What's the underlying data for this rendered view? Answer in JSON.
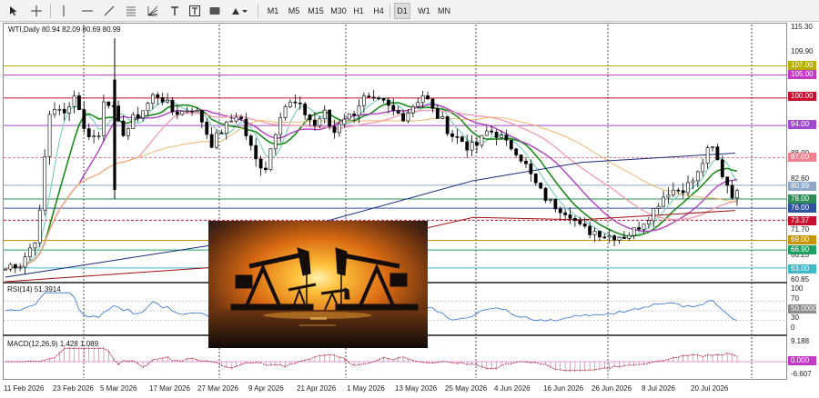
{
  "toolbar": {
    "tools": [
      "cursor-icon",
      "crosshair-icon",
      "vertical-line-icon",
      "horizontal-line-icon",
      "trendline-icon",
      "fibonacci-icon",
      "fibonacci-fan-icon",
      "text-icon",
      "rectangle-icon",
      "shapes-icon"
    ],
    "timeframes": [
      "M1",
      "M5",
      "M15",
      "M30",
      "H1",
      "H4",
      "D1",
      "W1",
      "MN"
    ],
    "active_timeframe": "D1"
  },
  "symbol_info": "WTI,Daily  80.94 82.09 80.69 80.99",
  "rsi": {
    "label": "RSI(14) 51.3914",
    "levels": [
      "100",
      "70",
      "50.0000",
      "30",
      "0"
    ]
  },
  "macd": {
    "label": "MACD(12,26,9) 1.428 1.089",
    "levels": [
      "9.188",
      "0.000",
      "-6.607"
    ]
  },
  "price_axis": [
    "115.30",
    "109.90",
    "88.00",
    "82.60",
    "71.70",
    "66.25",
    "60.85"
  ],
  "price_tags": [
    {
      "value": "107.00",
      "color": "#b5b000"
    },
    {
      "value": "105.00",
      "color": "#c53ac5"
    },
    {
      "value": "100.00",
      "color": "#c8102e"
    },
    {
      "value": "94.00",
      "color": "#a24bd1"
    },
    {
      "value": "87.00",
      "color": "#f08090"
    },
    {
      "value": "80.99",
      "color": "#8fa8c8"
    },
    {
      "value": "78.00",
      "color": "#2e8b57"
    },
    {
      "value": "76.00",
      "color": "#3050a0"
    },
    {
      "value": "73.37",
      "color": "#c8102e"
    },
    {
      "value": "69.00",
      "color": "#c89400"
    },
    {
      "value": "66.90",
      "color": "#20a060"
    },
    {
      "value": "63.00",
      "color": "#40b8c8"
    }
  ],
  "dates": [
    "11 Feb 2026",
    "23 Feb 2026",
    "5 Mar 2026",
    "17 Mar 2026",
    "27 Mar 2026",
    "9 Apr 2026",
    "21 Apr 2026",
    "1 May 2026",
    "13 May 2026",
    "25 May 2026",
    "4 Jun 2026",
    "16 Jun 2026",
    "26 Jun 2026",
    "8 Jul 2026",
    "20 Jul 2026"
  ],
  "colors": {
    "up": "#ffffff",
    "down": "#000000",
    "ma_fast": "#1a8a1a",
    "ma_mid": "#7fd0c0",
    "ma_slow": "#b040c0",
    "ma_long": "#f0a0b0",
    "ma_200": "#1a2a80"
  }
}
